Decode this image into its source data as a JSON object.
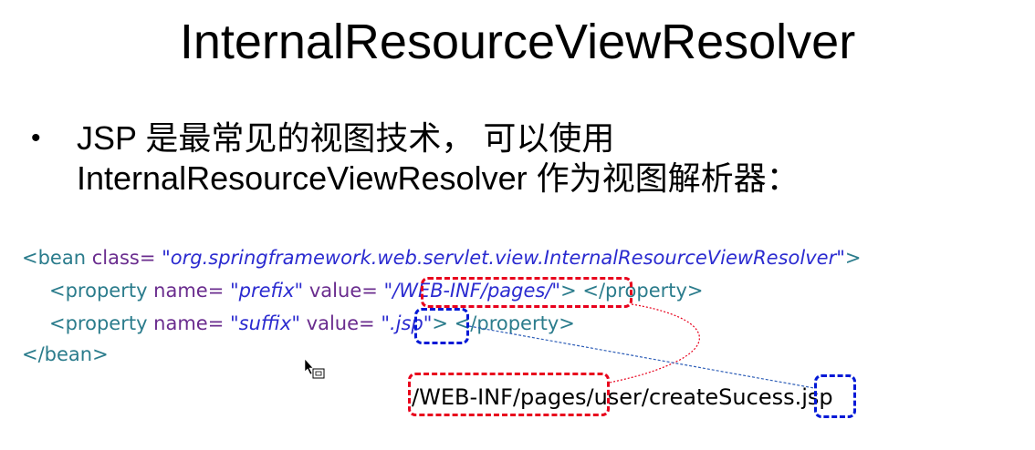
{
  "slide": {
    "title": "InternalResourceViewResolver",
    "bullet_line1": "JSP 是最常见的视图技术， 可以使用",
    "bullet_line2": "InternalResourceViewResolver 作为视图解析器："
  },
  "code": {
    "line1": {
      "open": "<bean ",
      "attr": "class=",
      "value": " \"org.springframework.web.servlet.view.InternalResourceViewResolver\"",
      "close": ">"
    },
    "line2": {
      "open": "<property ",
      "attr1": "name=",
      "value1": " \"prefix\"",
      "attr2": " value=",
      "value2": " \"/WEB-INF/pages/\"",
      "close": "> </property>"
    },
    "line3": {
      "open": "<property ",
      "attr1": "name=",
      "value1": " \"suffix\"",
      "attr2": " value=",
      "value2": " \".jsp\"",
      "close": "> </property>"
    },
    "line4": "</bean>"
  },
  "example": {
    "prefix": "/WEB-INF/pages/",
    "middle": "user/createSucess",
    "suffix": ".jsp"
  },
  "colors": {
    "prefix_highlight": "#e8001c",
    "suffix_highlight": "#0018d6",
    "xml_tag": "#2b7c8c",
    "xml_attr": "#6a2c8e",
    "xml_string": "#2b2bd0"
  }
}
